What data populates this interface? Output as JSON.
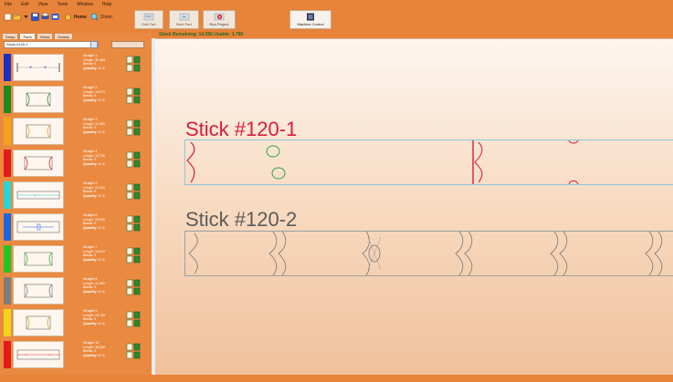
{
  "menu": [
    "File",
    "Edit",
    "View",
    "Tools",
    "Window",
    "Help"
  ],
  "toolbar": {
    "home_label": "Home",
    "zoom_label": "Zoom",
    "edit_part": "Edit Part",
    "next_part": "Next Part",
    "run_project": "Run Project",
    "machine_control": "Machine Control"
  },
  "status": {
    "text": "Stock Remaining: 14.556     Usable: 1.780"
  },
  "left_panel": {
    "tabs": [
      "Setup",
      "Parts",
      "Sticks",
      "Details"
    ],
    "active_tab": "Parts",
    "stick_select": "Stock #120-1"
  },
  "parts": [
    {
      "name": "Straight 1",
      "length": "Length: 36.484",
      "bends": "Bends: 0",
      "quantity": "Quantity: 1 / 1",
      "color": "#1f2fc2",
      "icon": "part-1-thumbnail"
    },
    {
      "name": "Straight 2",
      "length": "Length: 15.672",
      "bends": "Bends: 0",
      "quantity": "Quantity: 1 / 1",
      "color": "#1e8a1e",
      "icon": "part-2-thumbnail"
    },
    {
      "name": "Straight 3",
      "length": "Length: 11.500",
      "bends": "Bends: 0",
      "quantity": "Quantity: 1 / 1",
      "color": "#f0a41a",
      "icon": "part-3-thumbnail"
    },
    {
      "name": "Straight 4",
      "length": "Length: 15.750",
      "bends": "Bends: 0",
      "quantity": "Quantity: 1 / 1",
      "color": "#e01c1c",
      "icon": "part-4-thumbnail"
    },
    {
      "name": "Straight 5",
      "length": "Length: 22.000",
      "bends": "Bends: 0",
      "quantity": "Quantity: 1 / 1",
      "color": "#27d6d6",
      "icon": "part-5-thumbnail"
    },
    {
      "name": "Straight 6",
      "length": "Length: 23.000",
      "bends": "Bends: 0",
      "quantity": "Quantity: 1 / 1",
      "color": "#1a66e0",
      "icon": "part-6-thumbnail"
    },
    {
      "name": "Straight 7",
      "length": "Length: 15.672",
      "bends": "Bends: 0",
      "quantity": "Quantity: 1 / 1",
      "color": "#23c423",
      "icon": "part-7-thumbnail"
    },
    {
      "name": "Straight 8",
      "length": "Length: 11.500",
      "bends": "Bends: 0",
      "quantity": "Quantity: 1 / 1",
      "color": "#7d7d7d",
      "icon": "part-8-thumbnail"
    },
    {
      "name": "Straight 9",
      "length": "Length: 15.750",
      "bends": "Bends: 0",
      "quantity": "Quantity: 1 / 1",
      "color": "#f2d51a",
      "icon": "part-9-thumbnail"
    },
    {
      "name": "Straight 10",
      "length": "Length: 36.000",
      "bends": "Bends: 0",
      "quantity": "Quantity: 1 / 1",
      "color": "#e31b1b",
      "icon": "part-10-thumbnail"
    }
  ],
  "canvas": {
    "stick1_title": "Stick  #120-1",
    "stick2_title": "Stick  #120-2",
    "stick1_color": "#d81e3c",
    "stick2_color": "#5b5b5b"
  }
}
